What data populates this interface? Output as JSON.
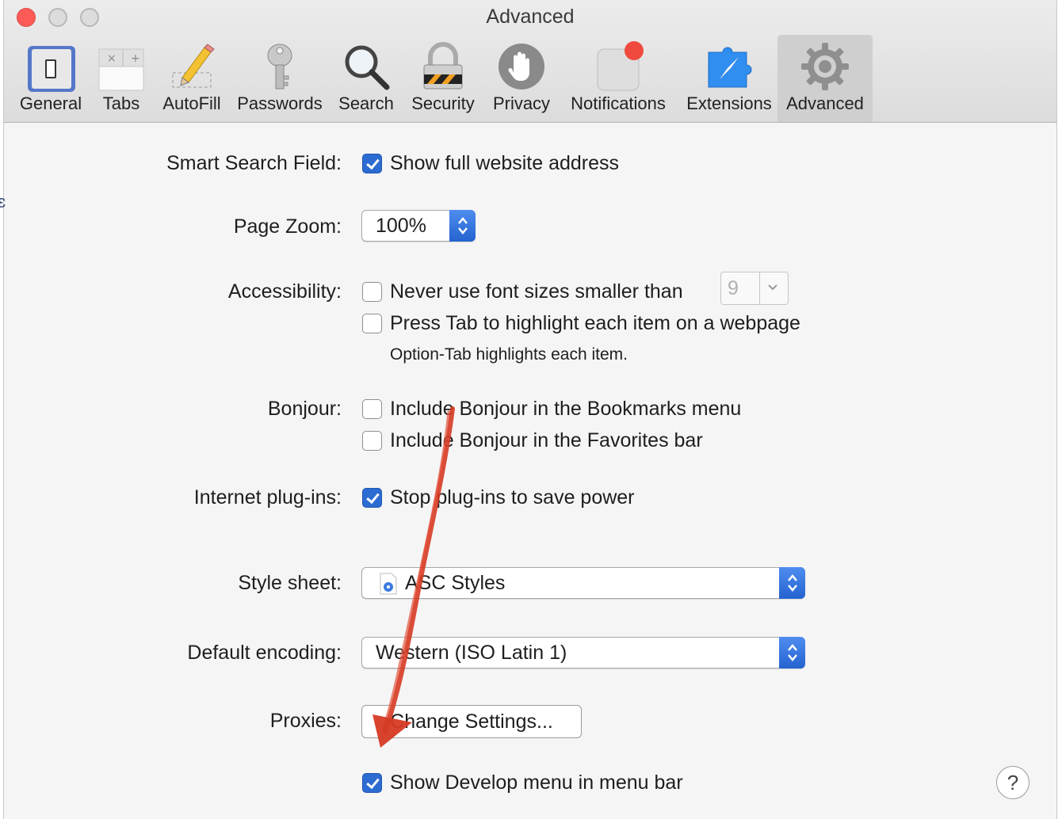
{
  "window": {
    "title": "Advanced"
  },
  "tabs": [
    {
      "label": "General",
      "icon": "general-switch-icon"
    },
    {
      "label": "Tabs",
      "icon": "tabs-icon"
    },
    {
      "label": "AutoFill",
      "icon": "pencil-icon"
    },
    {
      "label": "Passwords",
      "icon": "key-icon"
    },
    {
      "label": "Search",
      "icon": "magnifier-icon"
    },
    {
      "label": "Security",
      "icon": "padlock-icon"
    },
    {
      "label": "Privacy",
      "icon": "hand-icon"
    },
    {
      "label": "Notifications",
      "icon": "notification-badge-icon"
    },
    {
      "label": "Extensions",
      "icon": "puzzle-compass-icon"
    },
    {
      "label": "Advanced",
      "icon": "gear-icon",
      "selected": true
    }
  ],
  "settings": {
    "smart_search": {
      "label": "Smart Search Field:",
      "option": "Show full website address",
      "checked": true
    },
    "page_zoom": {
      "label": "Page Zoom:",
      "value": "100%"
    },
    "accessibility": {
      "label": "Accessibility:",
      "option1": "Never use font sizes smaller than",
      "option1_checked": false,
      "font_size": "9",
      "option2": "Press Tab to highlight each item on a webpage",
      "option2_checked": false,
      "note": "Option-Tab highlights each item."
    },
    "bonjour": {
      "label": "Bonjour:",
      "option1": "Include Bonjour in the Bookmarks menu",
      "option1_checked": false,
      "option2": "Include Bonjour in the Favorites bar",
      "option2_checked": false
    },
    "plugins": {
      "label": "Internet plug-ins:",
      "option": "Stop plug-ins to save power",
      "checked": true
    },
    "style_sheet": {
      "label": "Style sheet:",
      "value": "ASC Styles"
    },
    "encoding": {
      "label": "Default encoding:",
      "value": "Western (ISO Latin 1)"
    },
    "proxies": {
      "label": "Proxies:",
      "button": "Change Settings..."
    },
    "develop": {
      "option": "Show Develop menu in menu bar",
      "checked": true
    }
  },
  "help": {
    "label": "?"
  },
  "colors": {
    "accent": "#2c6bd1",
    "annotation_arrow": "#d63a24",
    "close": "#fc5b57"
  }
}
